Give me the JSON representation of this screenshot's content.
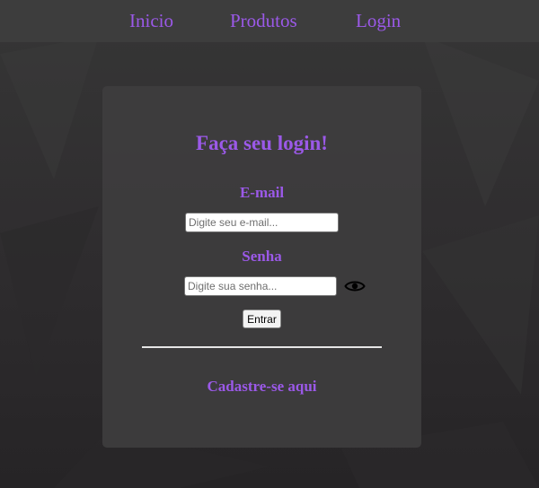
{
  "nav": {
    "items": [
      {
        "label": "Inicio"
      },
      {
        "label": "Produtos"
      },
      {
        "label": "Login"
      }
    ]
  },
  "login_form": {
    "title": "Faça seu login!",
    "email": {
      "label": "E-mail",
      "placeholder": "Digite seu e-mail...",
      "value": ""
    },
    "password": {
      "label": "Senha",
      "placeholder": "Digite sua senha...",
      "value": "",
      "toggle_icon": "eye-icon"
    },
    "submit_label": "Entrar",
    "signup_link": "Cadastre-se aqui"
  },
  "colors": {
    "accent": "#9b59e8",
    "navbar": "#3d3d3d",
    "card": "#3e3d3e",
    "background": "#2f2d2f",
    "divider": "#e6e6e6"
  }
}
